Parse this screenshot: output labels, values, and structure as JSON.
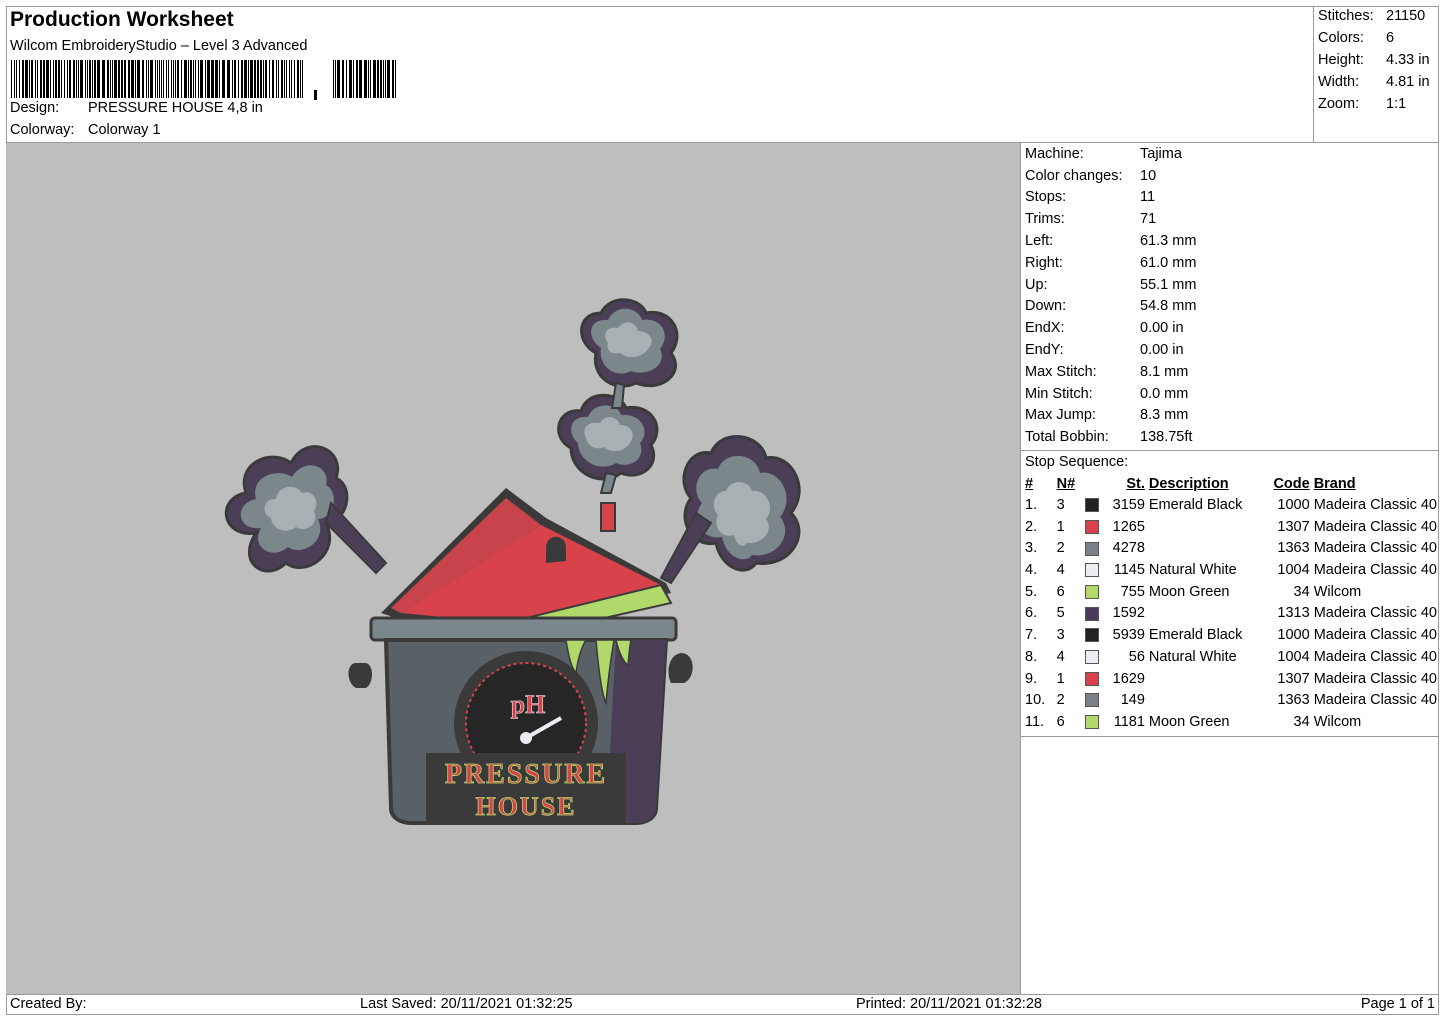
{
  "header": {
    "title": "Production Worksheet",
    "software": "Wilcom EmbroideryStudio – Level 3 Advanced",
    "design_label": "Design:",
    "design_value": "PRESSURE HOUSE 4,8 in",
    "colorway_label": "Colorway:",
    "colorway_value": "Colorway 1"
  },
  "summary": [
    {
      "label": "Stitches:",
      "value": "21150"
    },
    {
      "label": "Colors:",
      "value": "6"
    },
    {
      "label": "Height:",
      "value": "4.33 in"
    },
    {
      "label": "Width:",
      "value": "4.81 in"
    },
    {
      "label": "Zoom:",
      "value": "1:1"
    }
  ],
  "details": [
    {
      "label": "Machine:",
      "value": "Tajima"
    },
    {
      "label": "Color changes:",
      "value": "10"
    },
    {
      "label": "Stops:",
      "value": "11"
    },
    {
      "label": "Trims:",
      "value": "71"
    },
    {
      "label": "Left:",
      "value": "61.3 mm"
    },
    {
      "label": "Right:",
      "value": "61.0 mm"
    },
    {
      "label": "Up:",
      "value": "55.1 mm"
    },
    {
      "label": "Down:",
      "value": "54.8 mm"
    },
    {
      "label": "EndX:",
      "value": "0.00 in"
    },
    {
      "label": "EndY:",
      "value": "0.00 in"
    },
    {
      "label": "Max Stitch:",
      "value": "8.1 mm"
    },
    {
      "label": "Min Stitch:",
      "value": "0.0 mm"
    },
    {
      "label": "Max Jump:",
      "value": "8.3 mm"
    },
    {
      "label": "Total Bobbin:",
      "value": "138.75ft"
    }
  ],
  "stop_sequence": {
    "title": "Stop Sequence:",
    "headers": [
      "#",
      "N#",
      "St.",
      "Description",
      "Code",
      "Brand"
    ],
    "rows": [
      {
        "num": "1.",
        "n": "3",
        "color": "#222222",
        "st": "3159",
        "desc": "Emerald Black",
        "code": "1000",
        "brand": "Madeira Classic 40"
      },
      {
        "num": "2.",
        "n": "1",
        "color": "#d8434b",
        "st": "1265",
        "desc": "",
        "code": "1307",
        "brand": "Madeira Classic 40"
      },
      {
        "num": "3.",
        "n": "2",
        "color": "#7a8088",
        "st": "4278",
        "desc": "",
        "code": "1363",
        "brand": "Madeira Classic 40"
      },
      {
        "num": "4.",
        "n": "4",
        "color": "#ececf2",
        "st": "1145",
        "desc": "Natural White",
        "code": "1004",
        "brand": "Madeira Classic 40"
      },
      {
        "num": "5.",
        "n": "6",
        "color": "#b1d86a",
        "st": "755",
        "desc": "Moon Green",
        "code": "34",
        "brand": "Wilcom"
      },
      {
        "num": "6.",
        "n": "5",
        "color": "#4a3a5c",
        "st": "1592",
        "desc": "",
        "code": "1313",
        "brand": "Madeira Classic 40"
      },
      {
        "num": "7.",
        "n": "3",
        "color": "#222222",
        "st": "5939",
        "desc": "Emerald Black",
        "code": "1000",
        "brand": "Madeira Classic 40"
      },
      {
        "num": "8.",
        "n": "4",
        "color": "#ececf2",
        "st": "56",
        "desc": "Natural White",
        "code": "1004",
        "brand": "Madeira Classic 40"
      },
      {
        "num": "9.",
        "n": "1",
        "color": "#d8434b",
        "st": "1629",
        "desc": "",
        "code": "1307",
        "brand": "Madeira Classic 40"
      },
      {
        "num": "10.",
        "n": "2",
        "color": "#7a8088",
        "st": "149",
        "desc": "",
        "code": "1363",
        "brand": "Madeira Classic 40"
      },
      {
        "num": "11.",
        "n": "6",
        "color": "#b1d86a",
        "st": "1181",
        "desc": "Moon Green",
        "code": "34",
        "brand": "Wilcom"
      }
    ]
  },
  "design_art": {
    "logo_initials": "pH",
    "logo_line1": "PRESSURE",
    "logo_line2": "HOUSE"
  },
  "footer": {
    "created_by": "Created By:",
    "last_saved": "Last Saved: 20/11/2021 01:32:25",
    "printed": "Printed: 20/11/2021 01:32:28",
    "page": "Page 1 of 1"
  }
}
